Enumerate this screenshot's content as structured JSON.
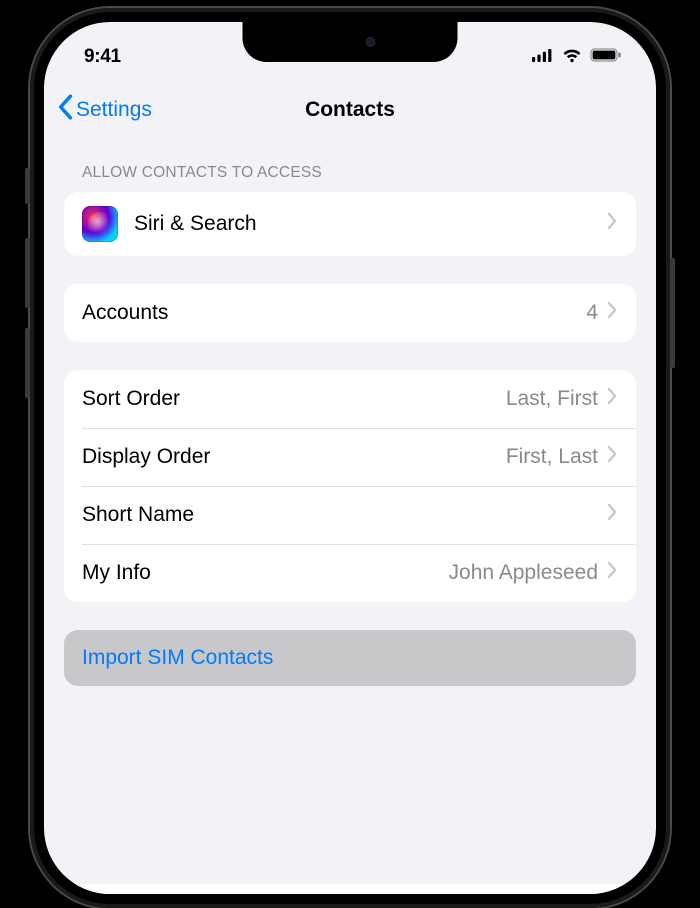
{
  "status": {
    "time": "9:41"
  },
  "nav": {
    "back_label": "Settings",
    "title": "Contacts"
  },
  "section1": {
    "header": "ALLOW CONTACTS TO ACCESS",
    "siri_label": "Siri & Search"
  },
  "accounts": {
    "label": "Accounts",
    "count": "4"
  },
  "prefs": {
    "sort_order": {
      "label": "Sort Order",
      "value": "Last, First"
    },
    "display_order": {
      "label": "Display Order",
      "value": "First, Last"
    },
    "short_name": {
      "label": "Short Name",
      "value": ""
    },
    "my_info": {
      "label": "My Info",
      "value": "John Appleseed"
    }
  },
  "action": {
    "import_label": "Import SIM Contacts"
  }
}
